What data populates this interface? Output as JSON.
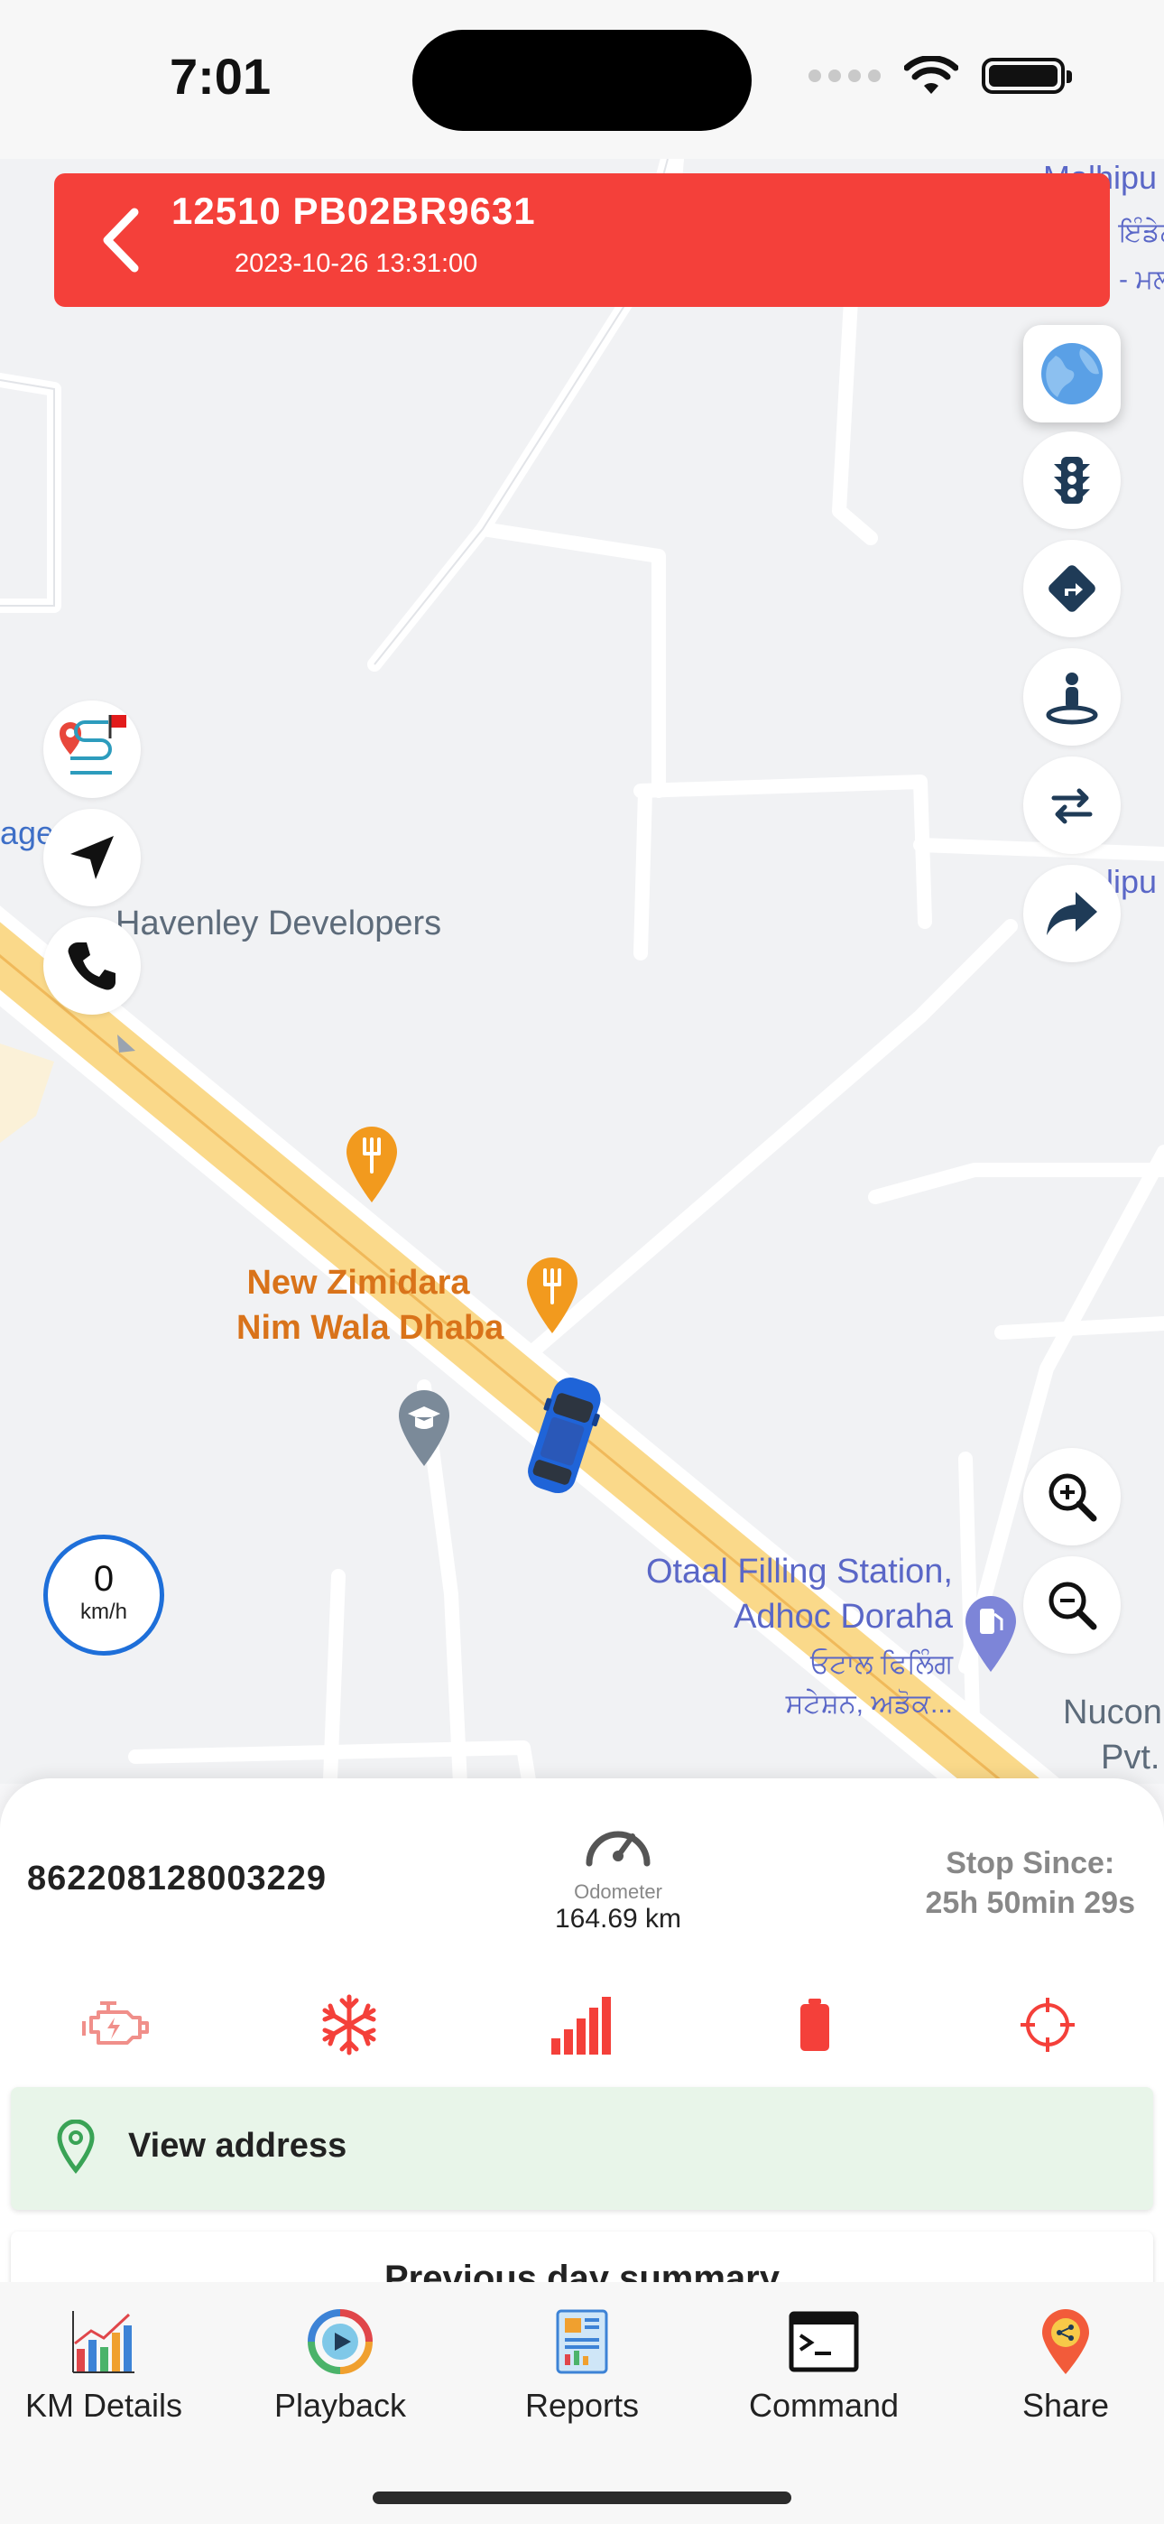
{
  "status_bar": {
    "time": "7:01"
  },
  "header": {
    "title": "12510 PB02BR9631",
    "timestamp": "2023-10-26 13:31:00",
    "color": "#f4403a"
  },
  "map": {
    "labels": {
      "havenley": "Havenley Developers",
      "dhaba_line1": "New Zimidara",
      "dhaba_line2": "Nim Wala Dhaba",
      "station_line1": "Otaal Filling Station,",
      "station_line2": "Adhoc Doraha",
      "station_pa_line1": "ਓਟਾਲ ਫਿਲਿੰਗ",
      "station_pa_line2": "ਸਟੇਸ਼ਨ, ਅਡੋਕ...",
      "edge_top_right_1": "Malhipu",
      "edge_top_right_2": "ਇੰਡੇਨ",
      "edge_top_right_3": "- ਮਲ੍",
      "edge_right_mid": "lipu",
      "edge_left": "age",
      "edge_bottom_right_1": "Nucon",
      "edge_bottom_right_2": "Pvt."
    },
    "right_controls": [
      "globe-icon",
      "traffic-light-icon",
      "directions-icon",
      "street-view-icon",
      "swap-icon",
      "share-arrow-icon"
    ],
    "left_controls": [
      "route-playback-icon",
      "navigate-icon",
      "phone-icon"
    ],
    "zoom_controls": [
      "zoom-in-icon",
      "zoom-out-icon"
    ],
    "speed": {
      "value": "0",
      "unit": "km/h"
    }
  },
  "panel": {
    "imei": "862208128003229",
    "odometer_label": "Odometer",
    "odometer_value": "164.69 km",
    "stop_since_label": "Stop Since:",
    "stop_since_value": "25h 50min 29s",
    "status_icons": [
      "engine-icon",
      "snowflake-icon",
      "signal-bars-icon",
      "battery-icon",
      "crosshair-icon"
    ],
    "status_color": "#f4403a",
    "address_button": "View address",
    "summary_title": "Previous day summary"
  },
  "nav": {
    "items": [
      {
        "label": "KM Details",
        "icon": "bar-chart-icon"
      },
      {
        "label": "Playback",
        "icon": "playback-icon"
      },
      {
        "label": "Reports",
        "icon": "reports-icon"
      },
      {
        "label": "Command",
        "icon": "terminal-icon"
      },
      {
        "label": "Share",
        "icon": "share-location-icon"
      }
    ]
  }
}
